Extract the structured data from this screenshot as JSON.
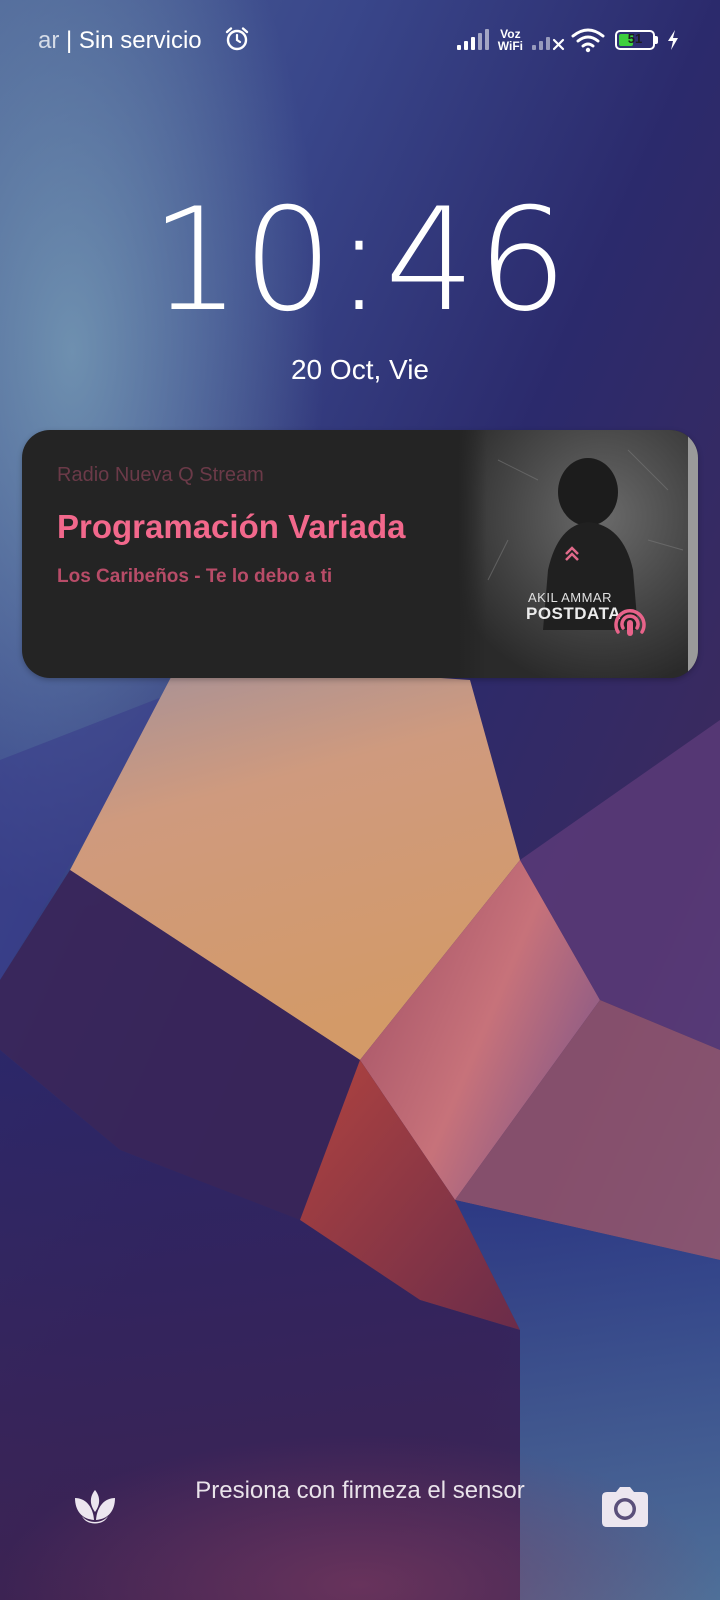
{
  "status_bar": {
    "carrier_fragment": "ar",
    "carrier_text": "| Sin servicio",
    "vowifi_top": "Voz",
    "vowifi_bottom": "WiFi",
    "battery_percent": "51",
    "battery_level": 0.51,
    "icons": [
      "alarm-icon",
      "signal-icon",
      "signal-off-icon",
      "wifi-icon",
      "battery-icon",
      "charging-bolt-icon"
    ]
  },
  "lockscreen": {
    "time": "10:46",
    "date": "20 Oct, Vie"
  },
  "media": {
    "station": "Radio Nueva Q Stream",
    "program": "Programación Variada",
    "track": "Los Caribeños - Te lo debo a ti",
    "album_artist": "AKIL AMMAR",
    "album_title": "POSTDATA",
    "colors": {
      "card_background": "#242424",
      "program_color": "#f2688c",
      "track_color": "#b84c68",
      "station_color": "#6b3a48"
    },
    "icons": [
      "cast-icon"
    ]
  },
  "bottom": {
    "hint": "Presiona con firmeza el sensor",
    "icons": [
      "flower-icon",
      "camera-icon"
    ]
  }
}
